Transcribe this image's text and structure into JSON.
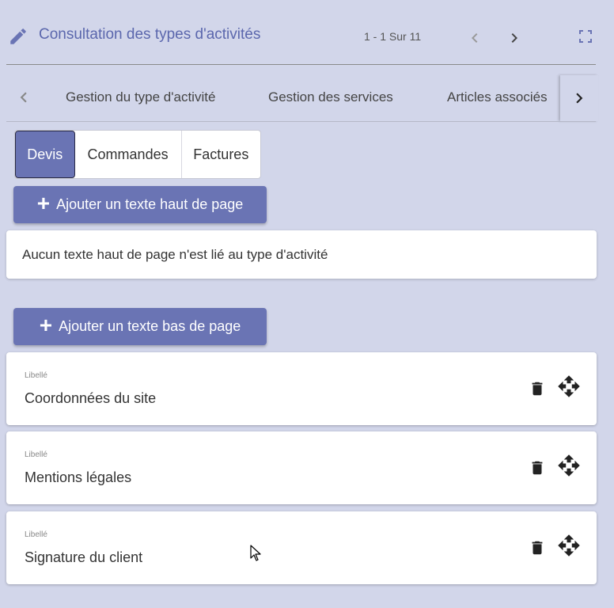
{
  "header": {
    "title": "Consultation des types d'activités",
    "pager": "1 - 1 Sur 11",
    "icons": {
      "edit": "pencil-icon",
      "prev": "chevron-left-icon",
      "next": "chevron-right-icon",
      "fullscreen": "fullscreen-icon"
    }
  },
  "tabs": [
    {
      "label": "Gestion du type d'activité"
    },
    {
      "label": "Gestion des services"
    },
    {
      "label": "Articles associés"
    }
  ],
  "toggle": {
    "options": [
      "Devis",
      "Commandes",
      "Factures"
    ],
    "selected": "Devis"
  },
  "header_section": {
    "add_button": "Ajouter un texte haut de page",
    "empty_message": "Aucun texte haut de page n'est lié au type d'activité"
  },
  "footer_section": {
    "add_button": "Ajouter un texte bas de page",
    "items": [
      {
        "label": "Libellé",
        "value": "Coordonnées du site"
      },
      {
        "label": "Libellé",
        "value": "Mentions légales"
      },
      {
        "label": "Libellé",
        "value": "Signature du client"
      }
    ]
  },
  "colors": {
    "background": "#d2d6ea",
    "accent": "#6a74b4",
    "title": "#5b67ad"
  }
}
